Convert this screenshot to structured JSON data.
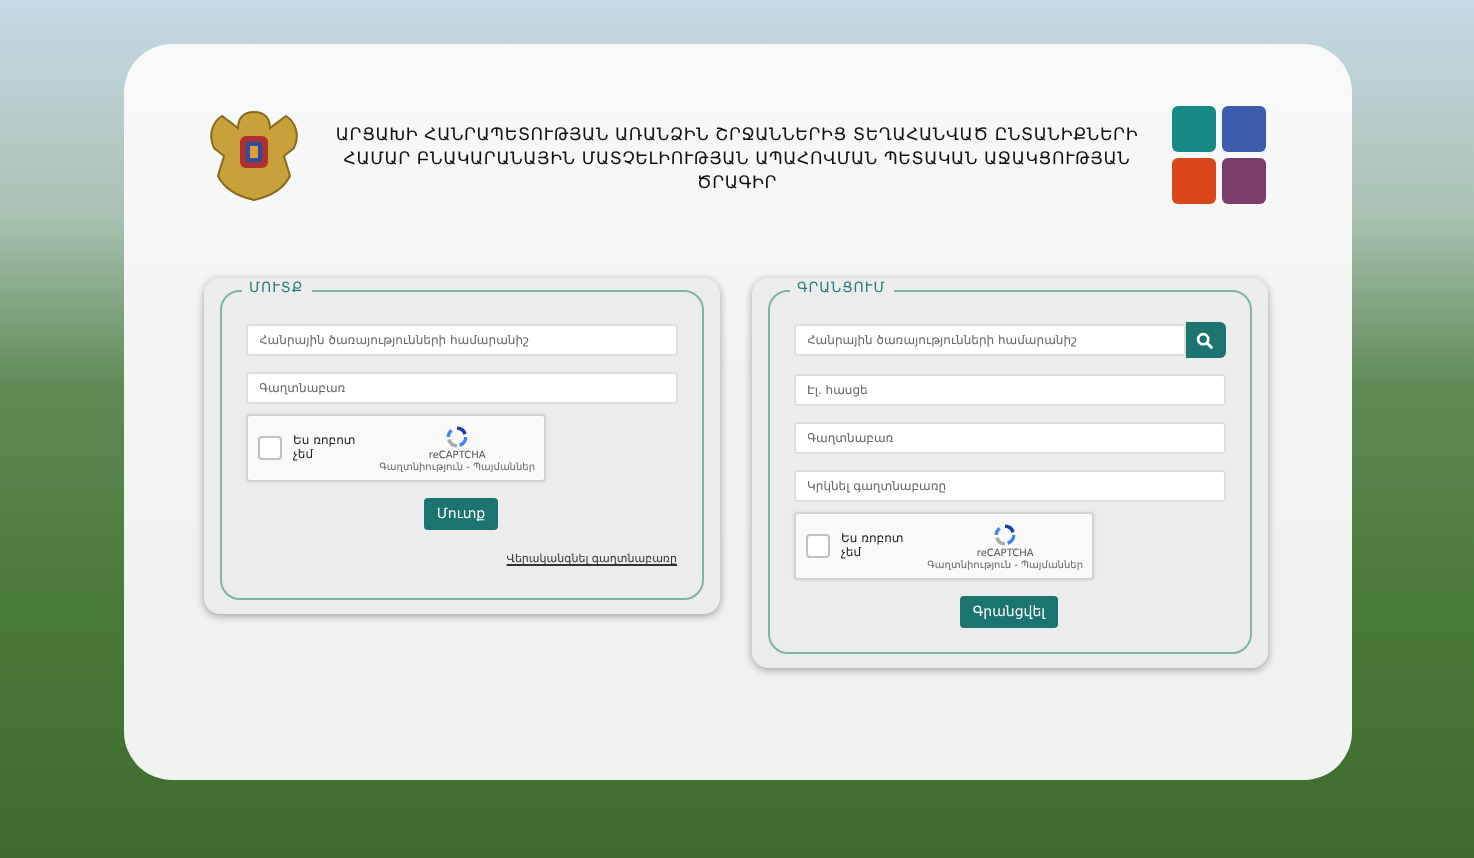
{
  "header": {
    "title": "ԱՐՑԱԽԻ ՀԱՆՐԱՊԵՏՈՒԹՅԱՆ ԱՌԱՆՁԻՆ ՇՐՋԱՆՆԵՐԻՑ ՏԵՂԱՀԱՆՎԱԾ ԸՆՏԱՆԻՔՆԵՐԻ ՀԱՄԱՐ ԲՆԱԿԱՐԱՆԱՅԻՆ ՄԱՏՉԵԼԻՈՒԹՅԱՆ ԱՊԱՀՈՎՄԱՆ ՊԵՏԱԿԱՆ ԱՋԱԿՑՈՒԹՅԱՆ ԾՐԱԳԻՐ"
  },
  "login": {
    "legend": "ՄՈՒՏՔ",
    "fields": [
      {
        "placeholder": "Հանրային ծառայությունների համարանիշ",
        "search": false
      },
      {
        "placeholder": "Գաղտնաբառ",
        "search": false
      }
    ],
    "captcha": {
      "label": "Ես ռոբոտ չեմ",
      "brand": "reCAPTCHA",
      "terms": "Գաղտնիություն - Պայմաններ",
      "checked": false
    },
    "button": "Մուտք",
    "link": "Վերականգնել գաղտնաբառը"
  },
  "register": {
    "legend": "ԳՐԱՆՑՈՒՄ",
    "fields": [
      {
        "placeholder": "Հանրային ծառայությունների համարանիշ",
        "search": true
      },
      {
        "placeholder": "Էլ. հասցե",
        "search": false
      },
      {
        "placeholder": "Գաղտնաբառ",
        "search": false
      },
      {
        "placeholder": "Կրկնել գաղտնաբառը",
        "search": false
      }
    ],
    "captcha": {
      "label": "Ես ռոբոտ չեմ",
      "brand": "reCAPTCHA",
      "terms": "Գաղտնիություն - Պայմաններ",
      "checked": false
    },
    "button": "Գրանցվել"
  }
}
